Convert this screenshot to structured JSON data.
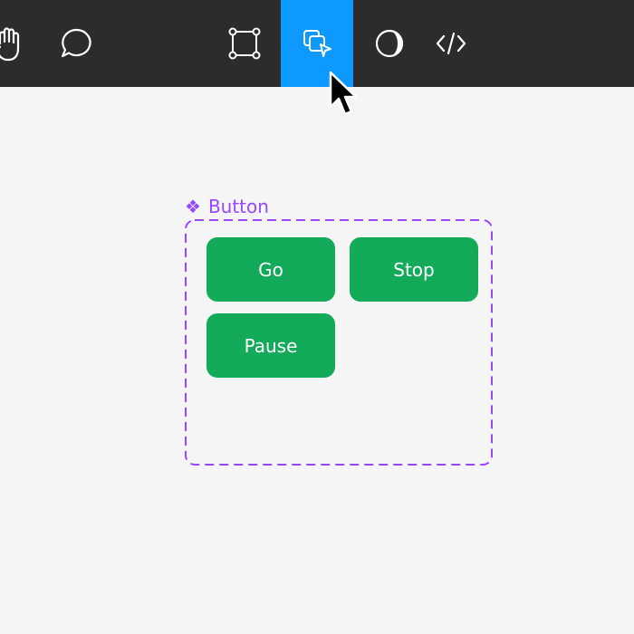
{
  "toolbar": {
    "tools": [
      {
        "icon": "hand-icon",
        "active": false
      },
      {
        "icon": "comment-icon",
        "active": false
      },
      {
        "icon": "frame-icon",
        "active": false
      },
      {
        "icon": "component-select-icon",
        "active": true
      },
      {
        "icon": "contrast-icon",
        "active": false
      },
      {
        "icon": "code-icon",
        "active": false
      }
    ],
    "active_color": "#0d99ff",
    "background_color": "#2c2c2c"
  },
  "component": {
    "icon": "component-diamond-icon",
    "label": "Button",
    "accent_color": "#9747ff",
    "variants": [
      {
        "label": "Go"
      },
      {
        "label": "Stop"
      },
      {
        "label": "Pause"
      }
    ],
    "button_color": "#13aa5a"
  }
}
